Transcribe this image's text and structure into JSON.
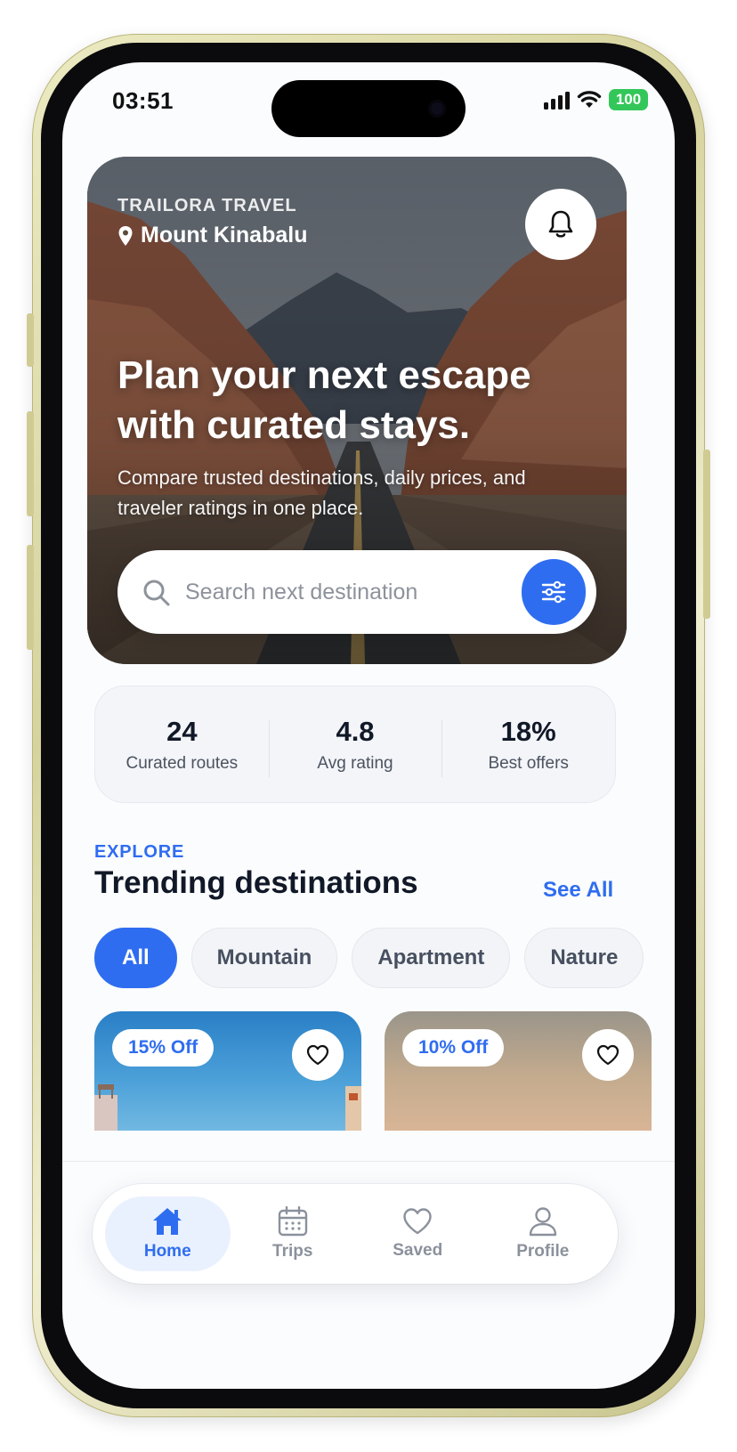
{
  "status_bar": {
    "time": "03:51",
    "battery": "100"
  },
  "hero": {
    "brand": "TRAILORA TRAVEL",
    "location": "Mount Kinabalu",
    "headline": "Plan your next escape with curated stays.",
    "subhead": "Compare trusted destinations, daily prices, and traveler ratings in one place.",
    "search_placeholder": "Search next destination"
  },
  "stats": [
    {
      "value": "24",
      "label": "Curated routes"
    },
    {
      "value": "4.8",
      "label": "Avg rating"
    },
    {
      "value": "18%",
      "label": "Best offers"
    }
  ],
  "section": {
    "eyebrow": "EXPLORE",
    "title": "Trending destinations",
    "see_all": "See All"
  },
  "chips": [
    {
      "label": "All",
      "active": true
    },
    {
      "label": "Mountain",
      "active": false
    },
    {
      "label": "Apartment",
      "active": false
    },
    {
      "label": "Nature",
      "active": false
    }
  ],
  "cards": [
    {
      "badge": "15% Off"
    },
    {
      "badge": "10% Off"
    }
  ],
  "nav": [
    {
      "label": "Home",
      "icon": "home-icon",
      "active": true
    },
    {
      "label": "Trips",
      "icon": "calendar-icon",
      "active": false
    },
    {
      "label": "Saved",
      "icon": "heart-icon",
      "active": false
    },
    {
      "label": "Profile",
      "icon": "user-icon",
      "active": false
    }
  ],
  "colors": {
    "accent": "#2f6df0",
    "battery": "#33c759",
    "text_dark": "#111827",
    "nav_inactive": "#8b919c"
  }
}
